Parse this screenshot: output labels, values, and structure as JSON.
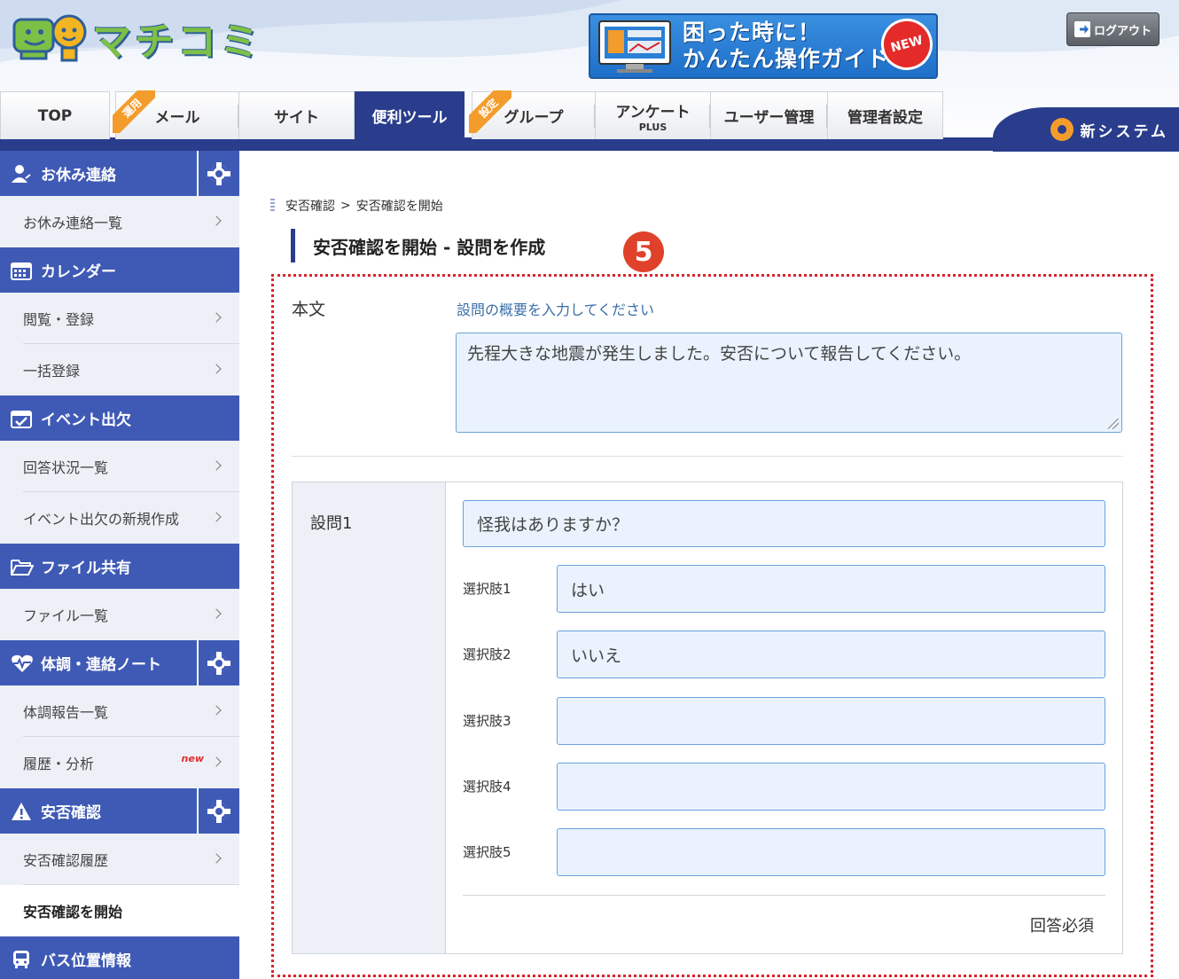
{
  "header": {
    "logo_text": "マチコミ",
    "guide": {
      "line1": "困った時に！",
      "line2": "かんたん操作ガイド",
      "badge": "NEW"
    },
    "logout_label": "ログアウト"
  },
  "nav": {
    "tabs": [
      {
        "label": "TOP"
      },
      {
        "label": "メール",
        "ribbon": "運用"
      },
      {
        "label": "サイト"
      },
      {
        "label": "便利ツール"
      },
      {
        "label": "グループ",
        "ribbon": "設定"
      },
      {
        "label": "アンケート",
        "sub": "PLUS"
      },
      {
        "label": "ユーザー管理"
      },
      {
        "label": "管理者設定"
      }
    ],
    "new_system": "新システム"
  },
  "sidebar": {
    "sections": [
      {
        "title": "お休み連絡",
        "items": [
          {
            "label": "お休み連絡一覧"
          }
        ]
      },
      {
        "title": "カレンダー",
        "items": [
          {
            "label": "閲覧・登録"
          },
          {
            "label": "一括登録"
          }
        ]
      },
      {
        "title": "イベント出欠",
        "items": [
          {
            "label": "回答状況一覧"
          },
          {
            "label": "イベント出欠の新規作成"
          }
        ]
      },
      {
        "title": "ファイル共有",
        "items": [
          {
            "label": "ファイル一覧"
          }
        ]
      },
      {
        "title": "体調・連絡ノート",
        "items": [
          {
            "label": "体調報告一覧"
          },
          {
            "label": "履歴・分析",
            "tag": "new"
          }
        ]
      },
      {
        "title": "安否確認",
        "items": [
          {
            "label": "安否確認履歴"
          },
          {
            "label": "安否確認を開始"
          }
        ]
      },
      {
        "title": "バス位置情報",
        "items": []
      }
    ]
  },
  "main": {
    "breadcrumb": {
      "parent": "安否確認",
      "separator": ">",
      "current": "安否確認を開始"
    },
    "page_title": "安否確認を開始 - 設問を作成",
    "step_badge": "5",
    "form": {
      "body_label": "本文",
      "body_hint": "設問の概要を入力してください",
      "body_value": "先程大きな地震が発生しました。安否について報告してください。",
      "question_label": "設問1",
      "question_value": "怪我はありますか？",
      "options": [
        {
          "label": "選択肢1",
          "value": "はい"
        },
        {
          "label": "選択肢2",
          "value": "いいえ"
        },
        {
          "label": "選択肢3",
          "value": ""
        },
        {
          "label": "選択肢4",
          "value": ""
        },
        {
          "label": "選択肢5",
          "value": ""
        }
      ],
      "required_label": "回答必須"
    }
  },
  "colors": {
    "nav_blue": "#293d8c",
    "side_blue": "#3f5ab5",
    "input_bg": "#eaf3fd",
    "accent_red": "#d9232b",
    "orange": "#f39c2c"
  }
}
